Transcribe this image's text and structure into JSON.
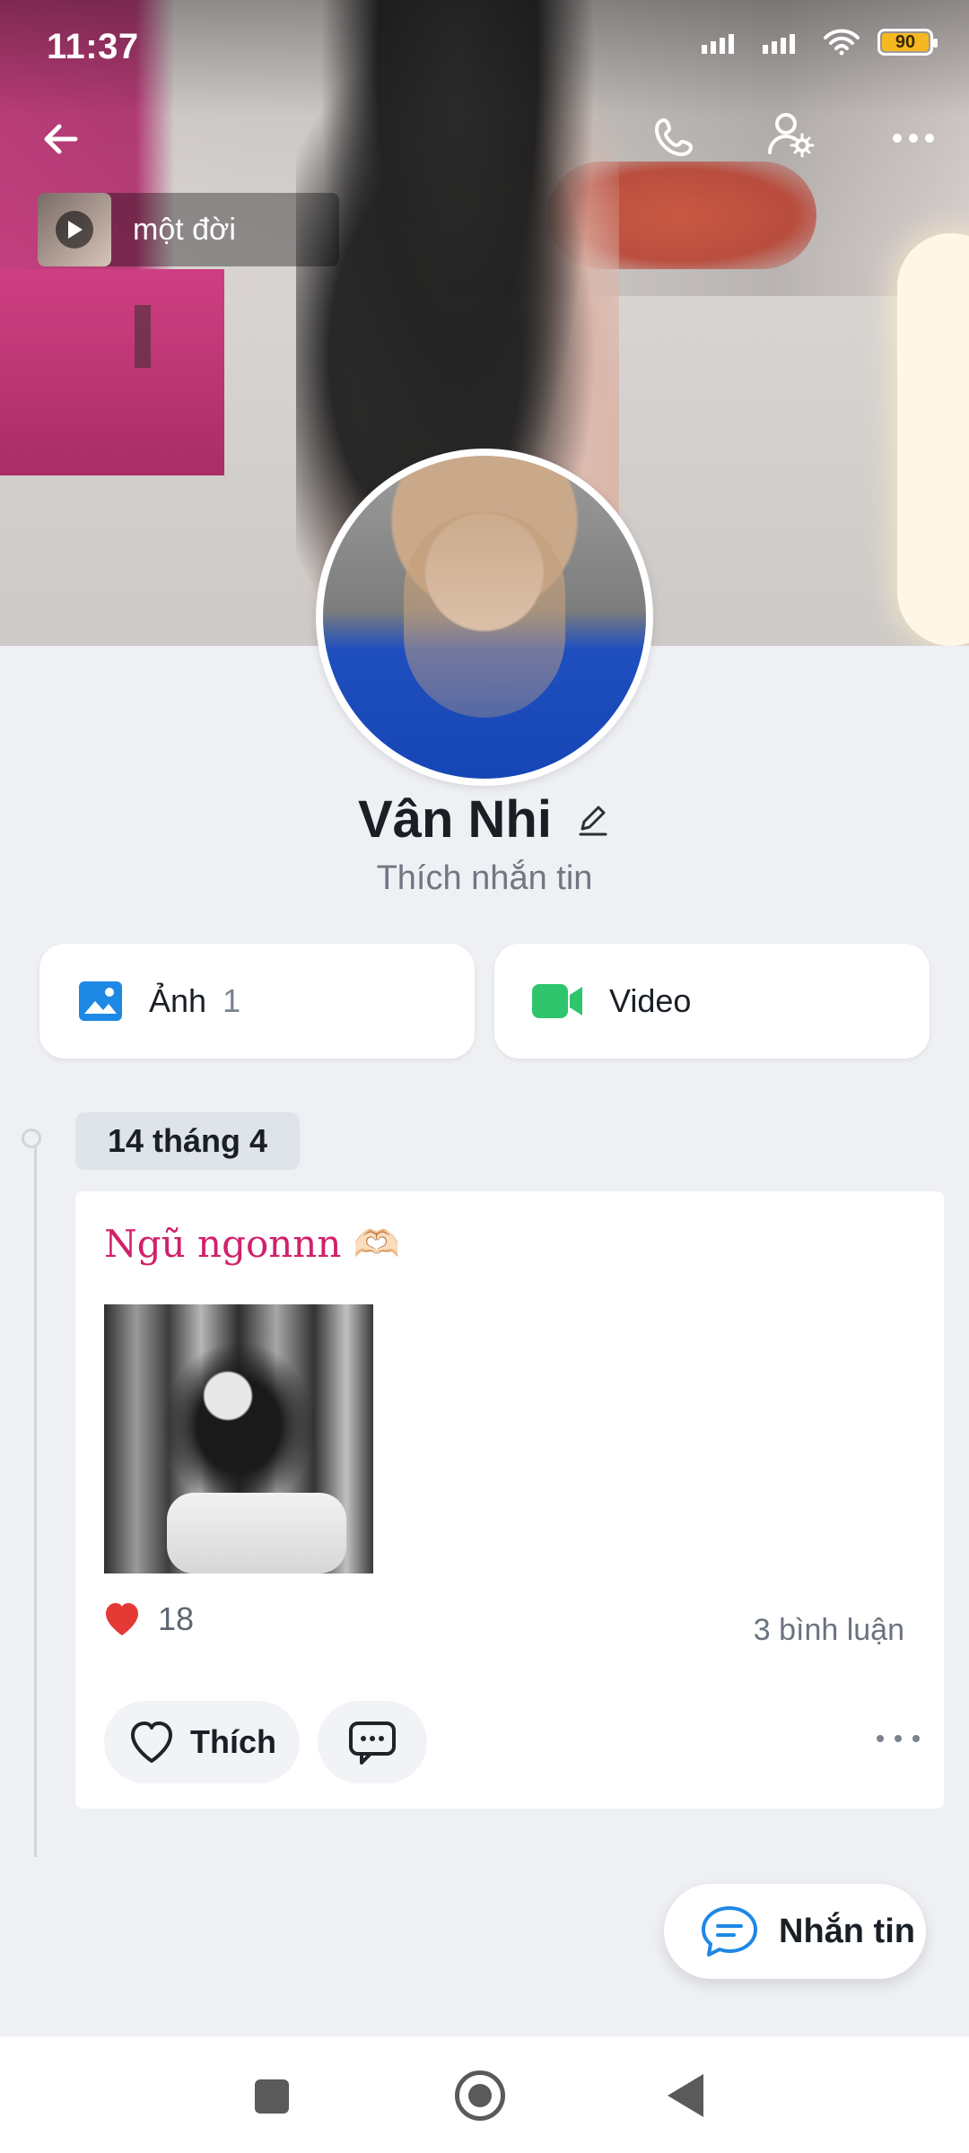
{
  "status_bar": {
    "time": "11:37",
    "battery": "90"
  },
  "music": {
    "title": "một đời"
  },
  "profile": {
    "name": "Vân Nhi",
    "status": "Thích nhắn tin"
  },
  "tiles": [
    {
      "label": "Ảnh",
      "count": "1"
    },
    {
      "label": "Video",
      "count": ""
    }
  ],
  "timeline": {
    "date": "14 tháng 4"
  },
  "post": {
    "caption": "Ngũ ngonnn 🫶🏻",
    "reactions": "18",
    "comments": "3 bình luận",
    "like_label": "Thích"
  },
  "fab": {
    "label": "Nhắn tin"
  },
  "icons": {
    "back": "arrow-left-icon",
    "call": "phone-icon",
    "settings": "user-settings-icon",
    "more": "more-horizontal-icon",
    "photo": "image-icon",
    "video": "video-icon",
    "heart": "heart-icon",
    "comment": "comment-icon",
    "message": "chat-icon"
  },
  "colors": {
    "accent_blue": "#1e88e5",
    "video_green": "#2ec56d",
    "caption_pink": "#d1206b"
  }
}
